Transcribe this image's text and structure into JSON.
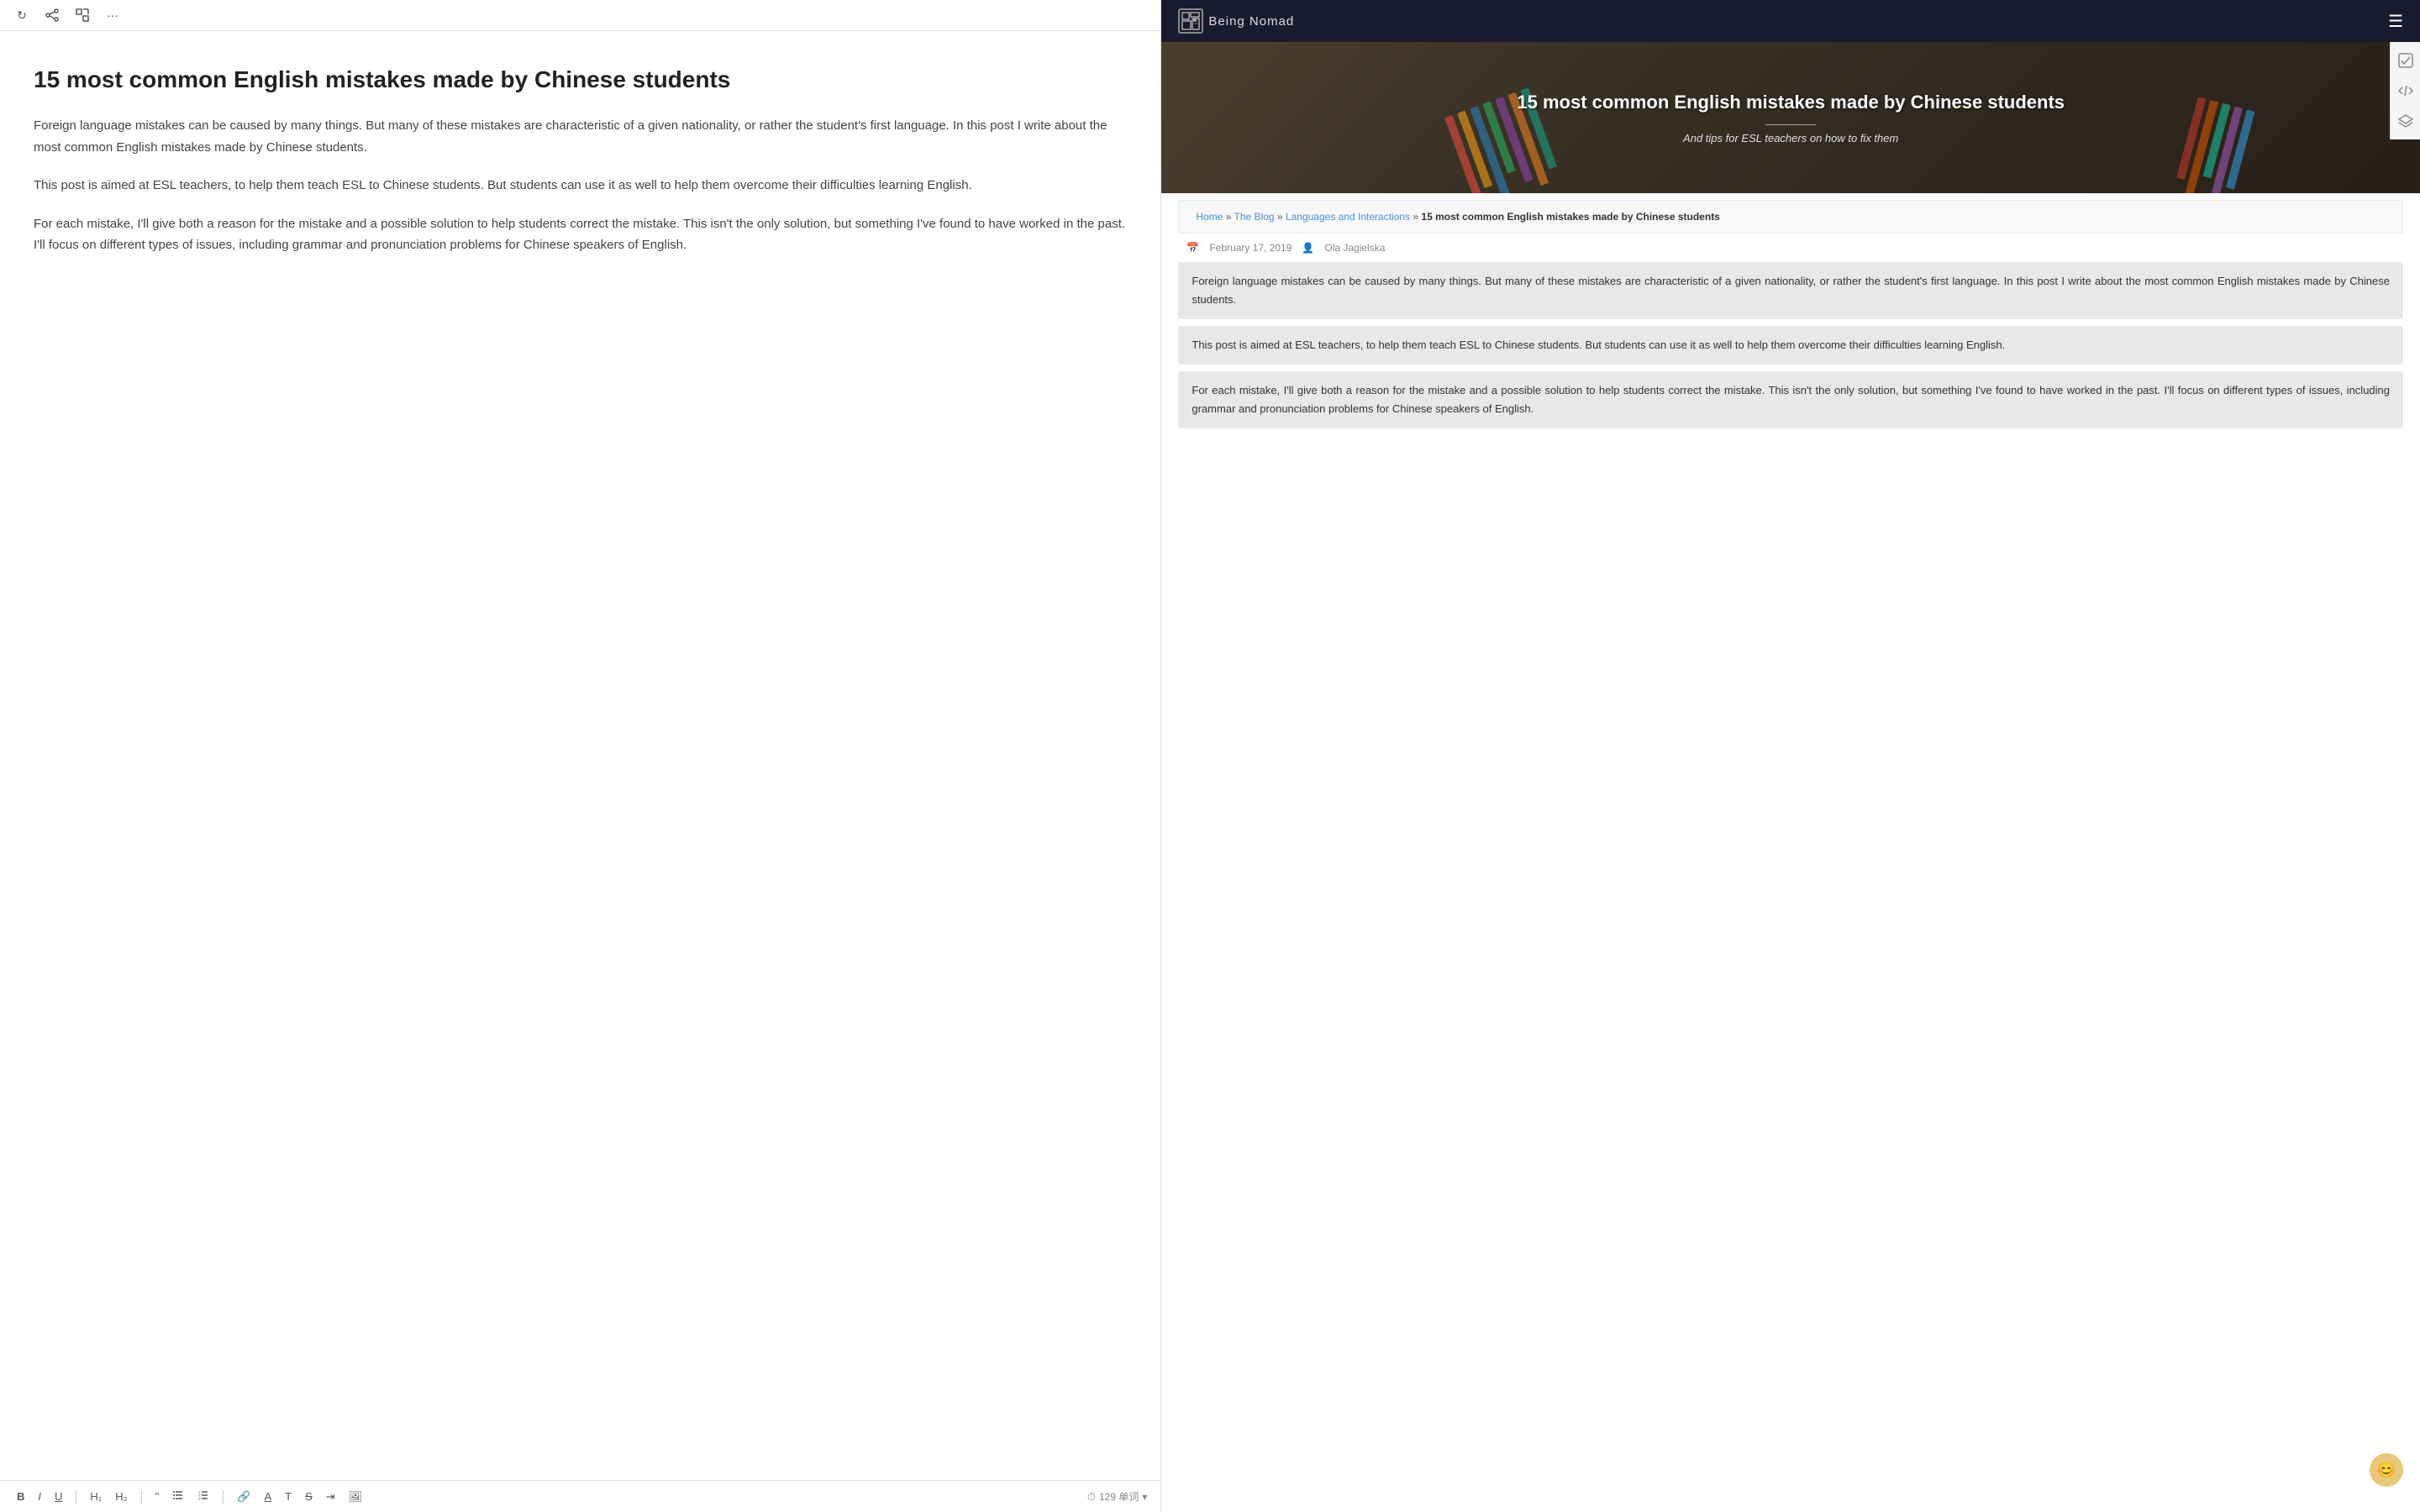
{
  "toolbar_top": {
    "icons": [
      "refresh",
      "share",
      "expand",
      "more"
    ]
  },
  "editor": {
    "title": "15 most common English mistakes made by Chinese students",
    "paragraphs": [
      "Foreign language mistakes can be caused by many things. But many of these mistakes are characteristic of a given nationality, or rather the student's first language. In this post I write about the most common English mistakes made by Chinese students.",
      "This post is aimed at ESL teachers, to help them teach ESL to Chinese students. But students can use it as well to help them overcome their difficulties learning English.",
      "For each mistake, I'll give both a reason for the mistake and a possible solution to help students correct the mistake. This isn't the only solution, but something I've found to have worked in the past. I'll focus on different types of issues, including grammar and pronunciation problems for Chinese speakers of English."
    ]
  },
  "format_toolbar": {
    "buttons": [
      "B",
      "I",
      "U",
      "H1",
      "H2",
      "\"",
      "• list",
      "1. list",
      "link",
      "underline-A",
      "T",
      "strikethrough",
      "indent",
      "image"
    ],
    "word_count": "129 单词"
  },
  "site": {
    "logo_text": "Being Nomad",
    "nav_brand": "BeingNomad"
  },
  "hero": {
    "title": "15 most common English mistakes made by Chinese students",
    "subtitle": "And tips for ESL teachers on how to fix them",
    "pencil_colors": [
      "#e74c3c",
      "#2980b9",
      "#27ae60",
      "#f39c12",
      "#8e44ad",
      "#16a085"
    ]
  },
  "breadcrumb": {
    "home": "Home",
    "blog": "The Blog",
    "category": "Languages and Interactions",
    "current": "15 most common English mistakes made by Chinese students"
  },
  "article": {
    "date": "February 17, 2019",
    "author": "Ola Jagielska",
    "paragraphs": [
      "Foreign language mistakes can be caused by many things. But many of these mistakes are characteristic of a given nationality, or rather the student's first language. In this post I write about the most common English mistakes made by Chinese students.",
      "This post is aimed at ESL teachers, to help them teach ESL to Chinese students. But students can use it as well to help them overcome their difficulties learning English.",
      "For each mistake, I'll give both a reason for the mistake and a possible solution to help students correct the mistake. This isn't the only solution, but something I've found to have worked in the past. I'll focus on different types of issues, including grammar and pronunciation problems for Chinese speakers of English."
    ]
  },
  "sidebar_icons": [
    "checkmark",
    "code",
    "layers"
  ],
  "floating": {
    "emoji": "😊"
  }
}
